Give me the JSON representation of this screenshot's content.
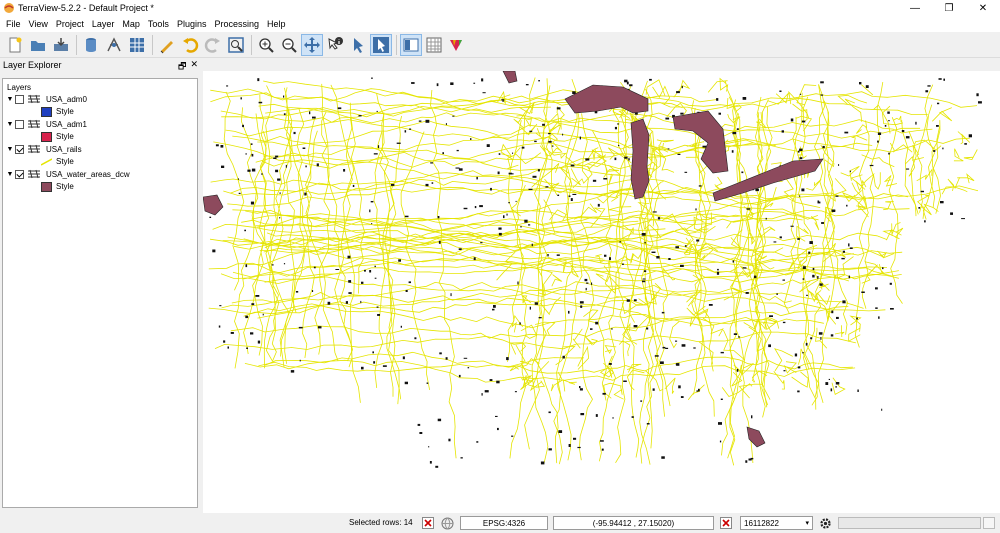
{
  "window": {
    "title": "TerraView-5.2.2 - Default Project *",
    "minimize": "—",
    "maximize": "❐",
    "close": "✕"
  },
  "menu": [
    "File",
    "View",
    "Project",
    "Layer",
    "Map",
    "Tools",
    "Plugins",
    "Processing",
    "Help"
  ],
  "dock": {
    "title": "Layer Explorer",
    "float": "🗗",
    "close": "✕",
    "tree_header": "Layers"
  },
  "layers": [
    {
      "name": "USA_adm0",
      "checked": false,
      "style_label": "Style",
      "style_color": "#1f3fbf",
      "style_type": "fill"
    },
    {
      "name": "USA_adm1",
      "checked": false,
      "style_label": "Style",
      "style_color": "#d8234d",
      "style_type": "fill"
    },
    {
      "name": "USA_rails",
      "checked": true,
      "style_label": "Style",
      "style_color": "#e5e500",
      "style_type": "line"
    },
    {
      "name": "USA_water_areas_dcw",
      "checked": true,
      "style_label": "Style",
      "style_color": "#8d4a5d",
      "style_type": "fill"
    }
  ],
  "map": {
    "rail_color": "#e5e500",
    "water_color": "#8d4a5d"
  },
  "status": {
    "selected_rows_label": "Selected rows: 14",
    "srid": "EPSG:4326",
    "coordinates": "(-95.94412 , 27.15020)",
    "scale": "16112822"
  }
}
